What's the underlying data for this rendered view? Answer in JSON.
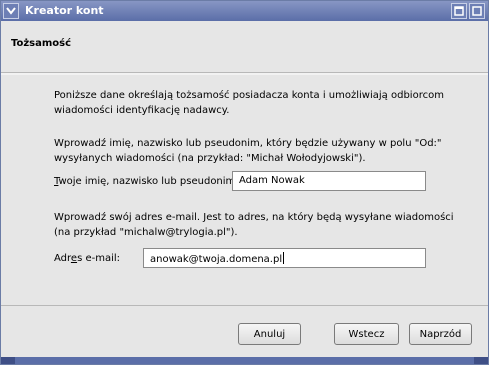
{
  "window": {
    "title": "Kreator kont"
  },
  "header": {
    "title": "Tożsamość"
  },
  "intro": {
    "line1": "Poniższe dane określają tożsamość posiadacza konta i umożliwiają odbiorcom",
    "line2": "wiadomości identyfikację nadawcy."
  },
  "name_section": {
    "line1": "Wprowadź imię, nazwisko lub pseudonim, który będzie używany w polu \"Od:\"",
    "line2": "wysyłanych wiadomości (na przykład: \"Michał Wołodyjowski\").",
    "label_prefix": "T",
    "label_rest": "woje imię, nazwisko lub pseudonim:",
    "value": "Adam Nowak"
  },
  "email_section": {
    "line1": "Wprowadź swój adres e-mail. Jest to adres, na który będą wysyłane wiadomości",
    "line2": "(na przykład \"michalw@trylogia.pl\").",
    "label_a": "Adr",
    "label_u": "e",
    "label_b": "s e-mail:",
    "value": "anowak@twoja.domena.pl"
  },
  "buttons": {
    "cancel": "Anuluj",
    "back": "Wstecz",
    "next": "Naprzód"
  }
}
